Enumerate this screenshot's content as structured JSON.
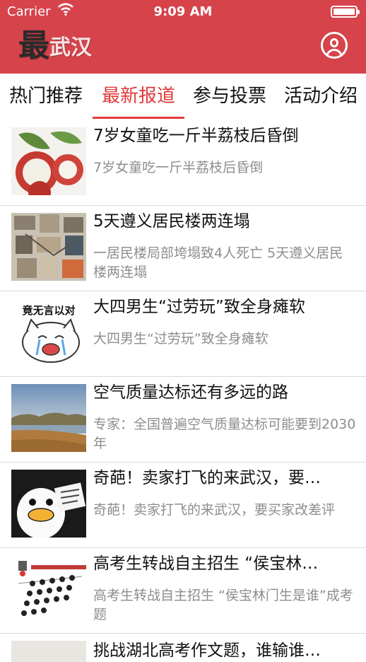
{
  "status_bar": {
    "carrier": "Carrier",
    "time": "9:09 AM"
  },
  "header": {
    "logo_main": "最",
    "logo_city": "武汉",
    "background": "#d6434b"
  },
  "tabs": [
    {
      "label": "热门推荐",
      "active": false
    },
    {
      "label": "最新报道",
      "active": true
    },
    {
      "label": "参与投票",
      "active": false
    },
    {
      "label": "活动介绍",
      "active": false
    }
  ],
  "news": [
    {
      "title": "7岁女童吃一斤半荔枝后昏倒",
      "summary": "7岁女童吃一斤半荔枝后昏倒",
      "thumb": "lychee"
    },
    {
      "title": " 5天遵义居民楼两连塌",
      "summary": "一居民楼局部垮塌致4人死亡 5天遵义居民楼两连塌",
      "thumb": "collapsed-building"
    },
    {
      "title": "大四男生“过劳玩”致全身瘫软",
      "summary": "大四男生“过劳玩”致全身瘫软",
      "thumb": "crying-cat-meme",
      "thumb_text": "竟无言以对"
    },
    {
      "title": "空气质量达标还有多远的路",
      "summary": "专家：全国普遍空气质量达标可能要到2030年",
      "thumb": "landscape"
    },
    {
      "title": "奇葩！卖家打飞的来武汉，要…",
      "summary": "奇葩！卖家打飞的来武汉，要买家改差评",
      "thumb": "duck-meme"
    },
    {
      "title": "高考生转战自主招生 “侯宝林…",
      "summary": "高考生转战自主招生 “侯宝林门生是谁”成考题",
      "thumb": "crowd-cartoon"
    },
    {
      "title": "挑战湖北高考作文题，谁输谁…",
      "summary": "",
      "thumb": ""
    }
  ]
}
